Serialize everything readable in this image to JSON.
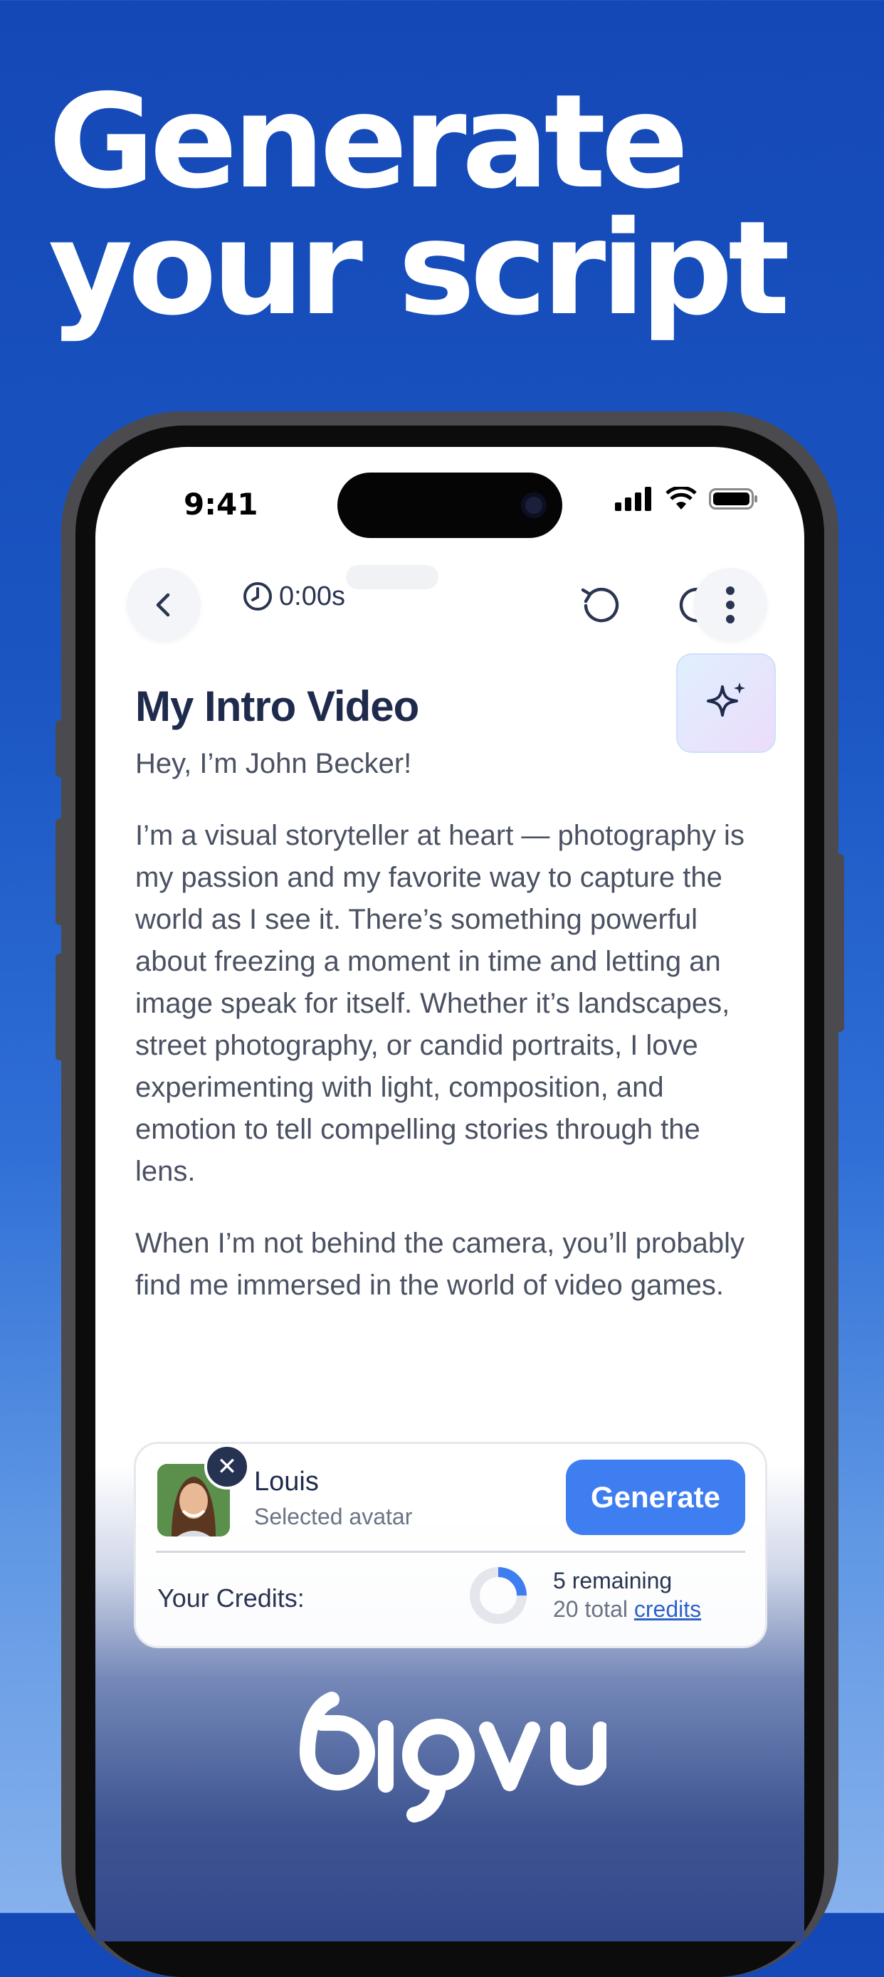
{
  "headline": {
    "line1": "Generate",
    "line2": "your script"
  },
  "status_bar": {
    "time": "9:41",
    "icons": [
      "signal-icon",
      "wifi-icon",
      "battery-icon"
    ]
  },
  "toolbar": {
    "timer": "0:00s",
    "icons": [
      "back-chevron-icon",
      "clock-icon",
      "undo-icon",
      "redo-icon",
      "more-vertical-icon",
      "sparkle-icon"
    ]
  },
  "document": {
    "title": "My Intro Video",
    "paragraphs": [
      "Hey, I’m John Becker!",
      "I’m a visual storyteller at heart — photography is my passion and my favorite way to capture the world as I see it. There’s something powerful about freezing a moment in time and letting an image speak for itself. Whether it’s landscapes, street photography, or candid portraits, I love experimenting with light, composition, and emotion to tell compelling stories through the lens.",
      "When I’m not behind the camera, you’ll probably find me immersed in the world of video games."
    ]
  },
  "avatar_card": {
    "name": "Louis",
    "subtitle": "Selected avatar",
    "generate_label": "Generate",
    "credits_label": "Your Credits:",
    "remaining_text": "5 remaining",
    "total_prefix": "20 total",
    "credits_link": "credits",
    "remaining_fraction": 0.25
  },
  "brand": {
    "logo_text": "bigvu"
  },
  "colors": {
    "accent": "#3f7ef0",
    "background_blue": "#1a55c2",
    "title_navy": "#1f2b4d"
  }
}
